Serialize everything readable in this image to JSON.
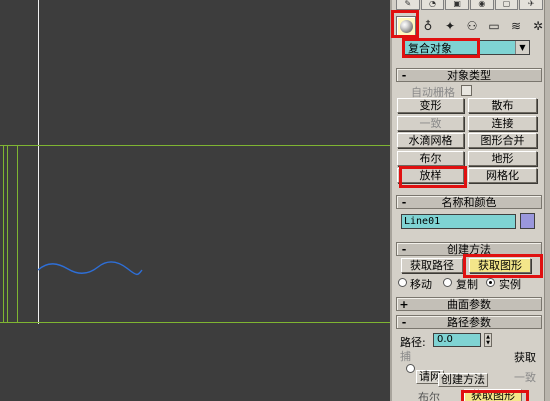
{
  "panel": {
    "object_category": "复合对象",
    "object_type": {
      "header": "对象类型",
      "autogrid_label": "自动栅格",
      "buttons": [
        "变形",
        "散布",
        "一致",
        "连接",
        "水滴网格",
        "图形合并",
        "布尔",
        "地形",
        "放样",
        "网格化"
      ]
    },
    "name_color": {
      "header": "名称和颜色",
      "name_value": "Line01",
      "swatch_color": "#9a97dc"
    },
    "creation_method": {
      "header": "创建方法",
      "get_path": "获取路径",
      "get_shape": "获取图形",
      "radio_move": "移动",
      "radio_copy": "复制",
      "radio_instance": "实例"
    },
    "surface_params": {
      "header": "曲面参数"
    },
    "path_params": {
      "header": "路径参数",
      "path_label": "路径:",
      "path_value": "0.0",
      "fetch_label": "获取",
      "catch_label": "捕"
    },
    "ghost": {
      "header": "创建方法",
      "btn_left": "请网",
      "btn_right": "获取图形",
      "consistent": "一致",
      "bool_label": "布尔",
      "fetch": "获取"
    }
  },
  "colors": {
    "highlight": "#e01010",
    "field_bg": "#7fd3d3",
    "viewport_bg": "#3d3d3d",
    "grid_green": "#7fb532",
    "spline_blue": "#2e6fd8"
  }
}
